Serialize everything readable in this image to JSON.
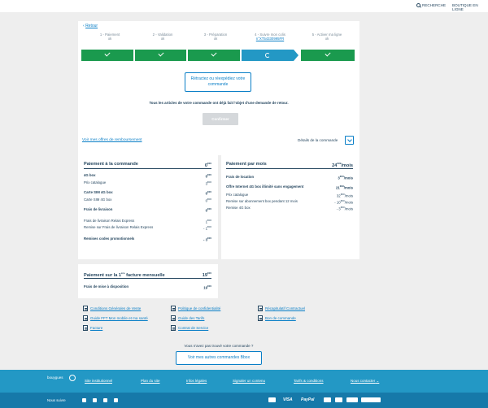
{
  "topbar": {
    "search_label": "RECHERCHE",
    "shop_label": "BOUTIQUE EN LIGNE"
  },
  "back": {
    "label": "Retour"
  },
  "steps": [
    {
      "label": "1 - Paiement",
      "status": "ok"
    },
    {
      "label": "2 - Validation",
      "status": "ok"
    },
    {
      "label": "3 - Préparation",
      "status": "ok"
    },
    {
      "label": "4 - Suivre mon colis",
      "status": "n°XT54330995FR"
    },
    {
      "label": "5 - Activer ma ligne",
      "status": "ok"
    }
  ],
  "actions": {
    "retract_label": "Rétractez ou réexpédiez votre commande",
    "notice": "Tous les articles de votre commande ont déjà fait l'objet d'une demande de retour.",
    "confirm_label": "Confirmer"
  },
  "offers_link": "Voir mes offres de remboursement",
  "details_label": "Détails de la commande",
  "order_payment": {
    "title": "Paiement à la commande",
    "total": "0",
    "total_cents": "€00",
    "rows": [
      {
        "label": "4G box",
        "value": "0",
        "cents": "€00",
        "bold": true
      },
      {
        "label": "Prix catalogue",
        "value": "3",
        "cents": "€00",
        "bold": false
      },
      {
        "label": "Carte SIM 4G box",
        "value": "0",
        "cents": "€00",
        "bold": true
      },
      {
        "label": "Carte SIM 4G box",
        "value": "0",
        "cents": "€00",
        "bold": false
      },
      {
        "label": "Frais de livraison",
        "value": "0",
        "cents": "€00",
        "bold": true
      },
      {
        "label": "Frais de livraison Relais Express",
        "value": "1",
        "cents": "€00",
        "bold": false
      },
      {
        "label": "Remise sur Frais de livraison Relais Express",
        "value": "- 1",
        "cents": "€00",
        "bold": false
      },
      {
        "label": "Remises codes promotionnels",
        "value": "- 3",
        "cents": "€00",
        "bold": true
      }
    ]
  },
  "monthly_payment": {
    "title": "Paiement par mois",
    "total": "24",
    "total_cents": "€99",
    "total_suffix": "/mois",
    "rows": [
      {
        "label": "Frais de location",
        "value": "3",
        "cents": "€00",
        "suffix": "/mois",
        "bold": true
      },
      {
        "label": "Offre Internet 4G box illimité sans engagement",
        "value": "21",
        "cents": "€99",
        "suffix": "/mois",
        "bold": true
      },
      {
        "label": "Prix catalogue",
        "value": "32",
        "cents": "€00",
        "suffix": "/mois",
        "bold": false
      },
      {
        "label": "Remise sur abonnement box pendant 12 mois",
        "value": "- 10",
        "cents": "€00",
        "suffix": "/mois",
        "bold": false
      },
      {
        "label": "Remise 4G box",
        "value": "- 3",
        "cents": "€00",
        "suffix": "/mois",
        "bold": false
      }
    ]
  },
  "first_invoice": {
    "title_pre": "Paiement sur la 1",
    "title_sup": "ère",
    "title_post": " facture mensuelle",
    "total": "19",
    "total_cents": "€00",
    "row_label": "Frais de mise à disposition",
    "row_value": "19",
    "row_cents": "€00"
  },
  "documents": [
    "Conditions Générales de Vente",
    "Politique de confidentialité",
    "Récapitulatif Contractuel",
    "Guide FFT Mon mobile et ma santé",
    "Guide des Tarifs",
    "Bon de commande",
    "Facture",
    "Contrat de Service"
  ],
  "not_found": "Vous n'avez pas trouvé votre commande ?",
  "more_orders_label": "Voir mes autres commandes  Bbox",
  "footer": {
    "brand": "bouygues",
    "links": [
      "Site institutionnel",
      "Plan du site",
      "Infos légales",
      "Signaler un contenu",
      "Tarifs & conditions",
      "Nous contacter"
    ],
    "follow": "Nous suivre",
    "payments": [
      "VISA",
      "PayPal"
    ]
  },
  "colors": {
    "accent": "#0a7fc7",
    "success": "#1a9a4e",
    "current_step": "#2398c5",
    "text": "#25465f",
    "footer": "#2398c5"
  }
}
